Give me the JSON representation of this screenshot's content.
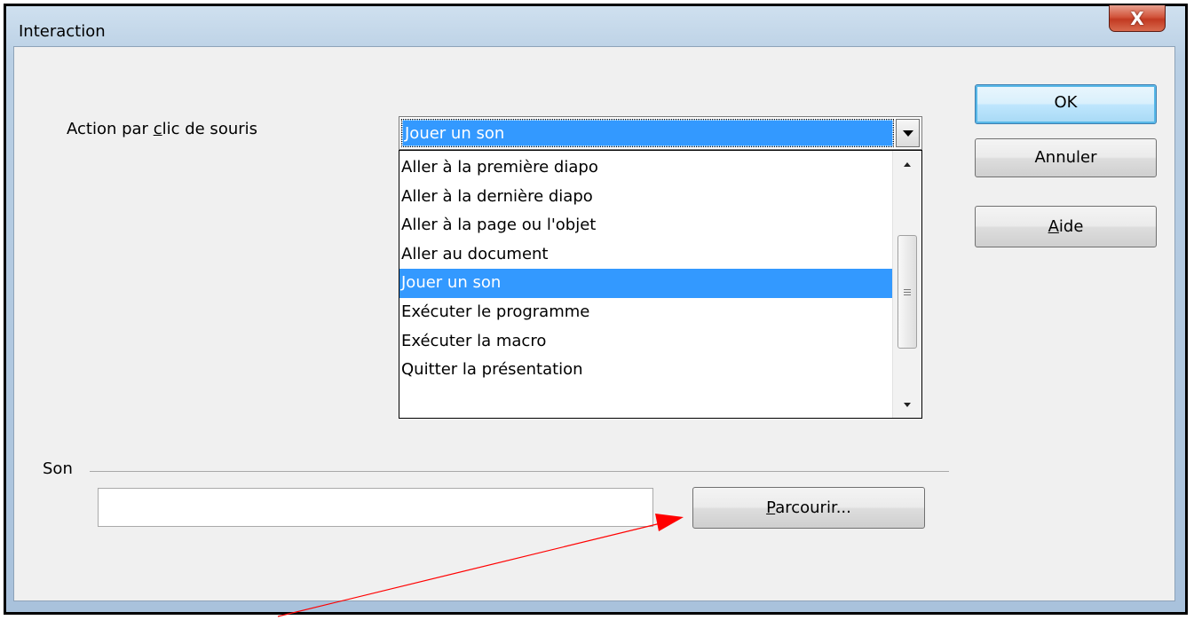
{
  "window": {
    "title": "Interaction",
    "close_label": "X"
  },
  "action": {
    "label_before": "Action par ",
    "label_mnemonic": "c",
    "label_after": "lic de souris",
    "selected_value": "Jouer un son",
    "options": [
      "Aller à la première diapo",
      "Aller à la dernière diapo",
      "Aller à la page ou l'objet",
      "Aller au document",
      "Jouer un son",
      "Exécuter le programme",
      "Exécuter la macro",
      "Quitter la présentation"
    ],
    "selected_index": 4
  },
  "buttons": {
    "ok": "OK",
    "cancel": "Annuler",
    "help_mnemonic": "A",
    "help_rest": "ide"
  },
  "son": {
    "section_label": "Son",
    "path_value": "",
    "browse_mnemonic": "P",
    "browse_rest": "arcourir..."
  },
  "colors": {
    "selection": "#3399ff",
    "annotation_arrow": "#ff0000",
    "close_button": "#c23a22"
  }
}
